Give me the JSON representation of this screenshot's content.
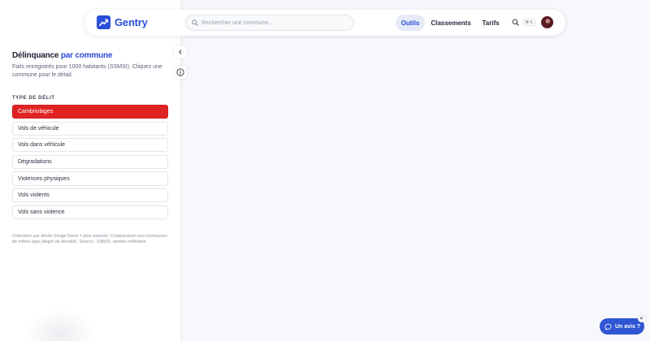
{
  "header": {
    "brand": "Gentry",
    "search": {
      "placeholder": "Rechercher une commune..."
    },
    "nav": [
      {
        "label": "Outils",
        "active": true
      },
      {
        "label": "Classements",
        "active": false
      },
      {
        "label": "Tarifs",
        "active": false
      }
    ],
    "shortcut": "⌘ K"
  },
  "panel": {
    "title_main": "Délinquance",
    "title_accent": "par commune",
    "subtitle": "Faits enregistrés pour 1000 habitants (SSMSI). Cliquez une commune pour le détail.",
    "section_label": "Type de délit",
    "options": [
      "Cambriolages",
      "Vols de véhicule",
      "Vols dans véhicule",
      "Dégradations",
      "Violences physiques",
      "Vols violents",
      "Vols sans violence"
    ],
    "selected_option": "Cambriolages",
    "legend_note": "Coloration par décile (rouge foncé = plus exposé). Comparaison aux communes de même type (degré de densité). Source : SSMSI, dernier millésime."
  },
  "feedback": {
    "label": "Un avis ?"
  },
  "colors": {
    "brand": "#2b4fd8",
    "active_option": "#e02424",
    "nav_active_bg": "#e7ebf8",
    "feedback_bg": "#2f55d4"
  },
  "icons": [
    "logo-chart-icon",
    "search-icon",
    "chevron-left-icon",
    "info-icon",
    "chat-bubble-icon",
    "close-icon"
  ]
}
